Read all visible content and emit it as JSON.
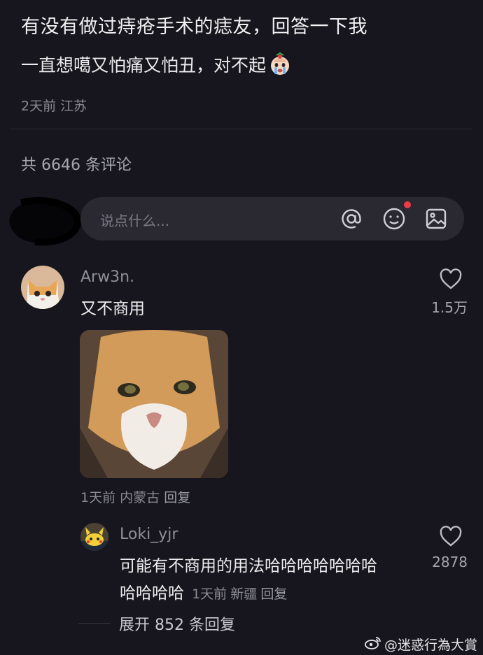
{
  "post": {
    "title": "有没有做过痔疮手术的痣友，回答一下我",
    "body": "一直想噶又怕痛又怕丑，对不起",
    "emoji_icon": "crying-face-emoji-icon",
    "time": "2天前",
    "location": "江苏"
  },
  "comments_header": {
    "count_text": "共 6646 条评论"
  },
  "input": {
    "placeholder": "说点什么...",
    "icons": [
      "at-icon",
      "emoji-icon",
      "image-icon"
    ],
    "badge_color": "#f03a48"
  },
  "comment": {
    "username": "Arw3n.",
    "text": "又不商用",
    "likes": "1.5万",
    "time": "1天前",
    "location": "内蒙古",
    "reply_label": "回复",
    "image": "cat-photo"
  },
  "reply": {
    "username": "Loki_yjr",
    "text_line1": "可能有不商用的用法哈哈哈哈哈哈哈",
    "text_line2": "哈哈哈哈",
    "likes": "2878",
    "time": "1天前",
    "location": "新疆",
    "reply_label": "回复"
  },
  "expand": {
    "label": "展开 852 条回复"
  },
  "watermark": {
    "text": "@迷惑行為大賞",
    "icon": "weibo-icon"
  },
  "colors": {
    "background": "#17161e",
    "input_bg": "#2a2932"
  }
}
